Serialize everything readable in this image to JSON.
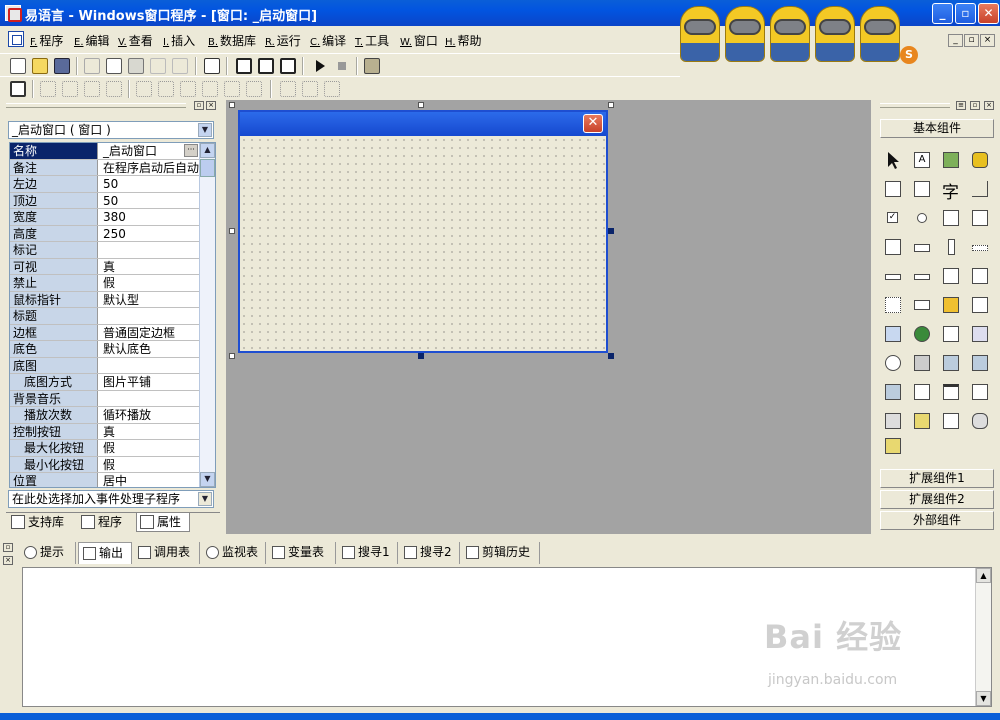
{
  "window": {
    "title": "易语言 - Windows窗口程序 - [窗口: _启动窗口]",
    "minimize": "_",
    "maximize": "▫",
    "close": "✕"
  },
  "mascot_badge": "S",
  "menu": [
    {
      "mnemonic": "F.",
      "label": "程序"
    },
    {
      "mnemonic": "E.",
      "label": "编辑"
    },
    {
      "mnemonic": "V.",
      "label": "查看"
    },
    {
      "mnemonic": "I.",
      "label": "插入"
    },
    {
      "mnemonic": "B.",
      "label": "数据库"
    },
    {
      "mnemonic": "R.",
      "label": "运行"
    },
    {
      "mnemonic": "C.",
      "label": "编译"
    },
    {
      "mnemonic": "T.",
      "label": "工具"
    },
    {
      "mnemonic": "W.",
      "label": "窗口"
    },
    {
      "mnemonic": "H.",
      "label": "帮助"
    }
  ],
  "properties": {
    "object_selector": "_启动窗口 ( 窗口 )",
    "rows": [
      {
        "name": "名称",
        "value": "_启动窗口"
      },
      {
        "name": "备注",
        "value": "在程序启动后自动"
      },
      {
        "name": "左边",
        "value": "50"
      },
      {
        "name": "顶边",
        "value": "50"
      },
      {
        "name": "宽度",
        "value": "380"
      },
      {
        "name": "高度",
        "value": "250"
      },
      {
        "name": "标记",
        "value": ""
      },
      {
        "name": "可视",
        "value": "真"
      },
      {
        "name": "禁止",
        "value": "假"
      },
      {
        "name": "鼠标指针",
        "value": "默认型"
      },
      {
        "name": "标题",
        "value": ""
      },
      {
        "name": "边框",
        "value": "普通固定边框"
      },
      {
        "name": "底色",
        "value": "默认底色"
      },
      {
        "name": "底图",
        "value": ""
      },
      {
        "name": "底图方式",
        "value": "图片平铺"
      },
      {
        "name": "背景音乐",
        "value": ""
      },
      {
        "name": "播放次数",
        "value": "循环播放"
      },
      {
        "name": "控制按钮",
        "value": "真"
      },
      {
        "name": "最大化按钮",
        "value": "假"
      },
      {
        "name": "最小化按钮",
        "value": "假"
      },
      {
        "name": "位置",
        "value": "居中"
      }
    ],
    "event_selector": "在此处选择加入事件处理子程序",
    "tabs": [
      "支持库",
      "程序",
      "属性"
    ],
    "active_tab": "属性"
  },
  "components": {
    "basic": "基本组件",
    "extended1": "扩展组件1",
    "extended2": "扩展组件2",
    "external": "外部组件",
    "tool_glyphs": [
      "",
      "A",
      "",
      "",
      "",
      "",
      "字",
      "",
      "",
      "",
      "",
      "",
      "",
      "",
      "",
      "",
      "",
      "",
      "",
      "",
      "",
      "",
      "",
      "",
      "",
      "",
      "",
      "",
      "",
      "",
      "",
      "",
      "",
      "",
      "",
      "",
      "",
      "",
      "",
      "",
      ""
    ]
  },
  "output": {
    "tabs": [
      "提示",
      "输出",
      "调用表",
      "监视表",
      "变量表",
      "搜寻1",
      "搜寻2",
      "剪辑历史"
    ],
    "active_tab": "输出"
  },
  "watermark": {
    "main": "Bai 经验",
    "sub": "jingyan.baidu.com"
  }
}
